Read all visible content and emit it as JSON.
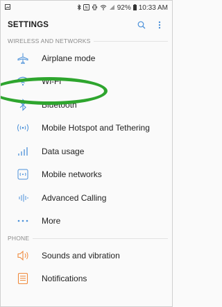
{
  "status_bar": {
    "left_icon": "image-icon",
    "battery": "92%",
    "time": "10:33 AM",
    "icons": [
      "bluetooth-icon",
      "nfc-icon",
      "vibrate-icon",
      "wifi-icon",
      "signal-icon",
      "battery-icon"
    ]
  },
  "appbar": {
    "title": "SETTINGS",
    "actions": [
      "search-icon",
      "more-vert-icon"
    ]
  },
  "sections": [
    {
      "header": "WIRELESS AND NETWORKS",
      "items": [
        {
          "label": "Airplane mode",
          "icon": "airplane-icon"
        },
        {
          "label": "Wi-Fi",
          "icon": "wifi-icon"
        },
        {
          "label": "Bluetooth",
          "icon": "bluetooth-icon"
        },
        {
          "label": "Mobile Hotspot and Tethering",
          "icon": "hotspot-icon"
        },
        {
          "label": "Data usage",
          "icon": "data-usage-icon"
        },
        {
          "label": "Mobile networks",
          "icon": "mobile-networks-icon"
        },
        {
          "label": "Advanced Calling",
          "icon": "advanced-calling-icon"
        },
        {
          "label": "More",
          "icon": "more-horiz-icon"
        }
      ]
    },
    {
      "header": "PHONE",
      "items": [
        {
          "label": "Sounds and vibration",
          "icon": "sound-icon"
        },
        {
          "label": "Notifications",
          "icon": "notifications-icon"
        }
      ]
    }
  ],
  "colors": {
    "icon_blue": "#4a90d9",
    "icon_orange": "#f08a3c",
    "annotation_green": "#2ea52e"
  }
}
